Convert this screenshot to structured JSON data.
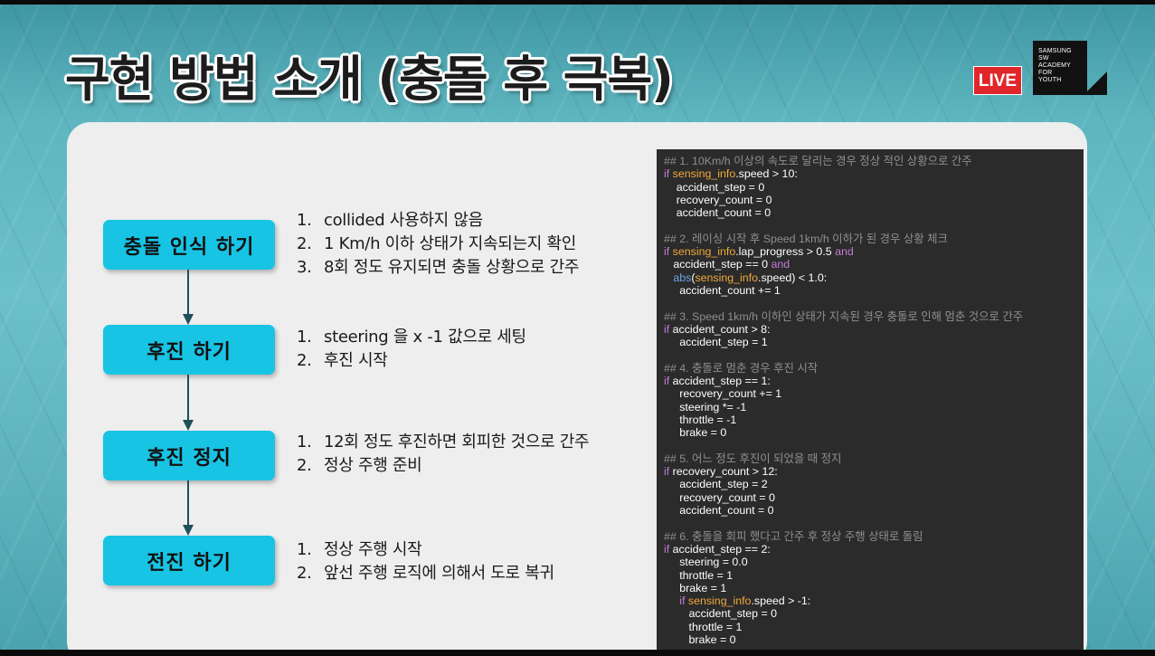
{
  "title": "구현 방법 소개 (충돌 후 극복)",
  "live_badge": "LIVE",
  "logo": {
    "lines": [
      "SAMSUNG",
      "SW",
      "ACADEMY",
      "FOR",
      "YOUTH"
    ]
  },
  "colors": {
    "background": "#5fb6c0",
    "step_box": "#18c4e4",
    "live": "#e0262b",
    "code_bg": "#2b2b2b",
    "code_comment": "#8f8f8f",
    "code_keyword": "#c57ad6",
    "code_variable": "#f0a93a",
    "code_builtin": "#6aa3e6"
  },
  "steps": [
    {
      "label": "충돌 인식 하기",
      "items": [
        {
          "num": "1.",
          "text": "collided 사용하지 않음"
        },
        {
          "num": "2.",
          "text": "1 Km/h 이하 상태가 지속되는지 확인"
        },
        {
          "num": "3.",
          "text": "8회 정도 유지되면 충돌 상황으로 간주"
        }
      ]
    },
    {
      "label": "후진 하기",
      "items": [
        {
          "num": "1.",
          "text": "steering 을 x -1 값으로 세팅"
        },
        {
          "num": "2.",
          "text": "후진 시작"
        }
      ]
    },
    {
      "label": "후진 정지",
      "items": [
        {
          "num": "1.",
          "text": "12회 정도 후진하면 회피한 것으로 간주"
        },
        {
          "num": "2.",
          "text": "정상 주행 준비"
        }
      ]
    },
    {
      "label": "전진 하기",
      "items": [
        {
          "num": "1.",
          "text": "정상 주행 시작"
        },
        {
          "num": "2.",
          "text": "앞선 주행 로직에 의해서 도로 복귀"
        }
      ]
    }
  ],
  "code_lines": [
    "## 1. 10Km/h 이상의 속도로 달리는 경우 정상 적인 상황으로 간주",
    "if sensing_info.speed > 10:",
    "    accident_step = 0",
    "    recovery_count = 0",
    "    accident_count = 0",
    "",
    "## 2. 레이싱 시작 후 Speed 1km/h 이하가 된 경우 상황 체크",
    "if sensing_info.lap_progress > 0.5 and",
    "   accident_step == 0 and",
    "   abs(sensing_info.speed) < 1.0:",
    "     accident_count += 1",
    "",
    "## 3. Speed 1km/h 이하인 상태가 지속된 경우 충돌로 인해 멈춘 것으로 간주",
    "if accident_count > 8:",
    "     accident_step = 1",
    "",
    "## 4. 충돌로 멈춘 경우 후진 시작",
    "if accident_step == 1:",
    "     recovery_count += 1",
    "     steering *= -1",
    "     throttle = -1",
    "     brake = 0",
    "",
    "## 5. 어느 정도 후진이 되었을 때 정지",
    "if recovery_count > 12:",
    "     accident_step = 2",
    "     recovery_count = 0",
    "     accident_count = 0",
    "",
    "## 6. 충돌을 회피 했다고 간주 후 정상 주행 상태로 돌림",
    "if accident_step == 2:",
    "     steering = 0.0",
    "     throttle = 1",
    "     brake = 1",
    "     if sensing_info.speed > -1:",
    "        accident_step = 0",
    "        throttle = 1",
    "        brake = 0"
  ]
}
